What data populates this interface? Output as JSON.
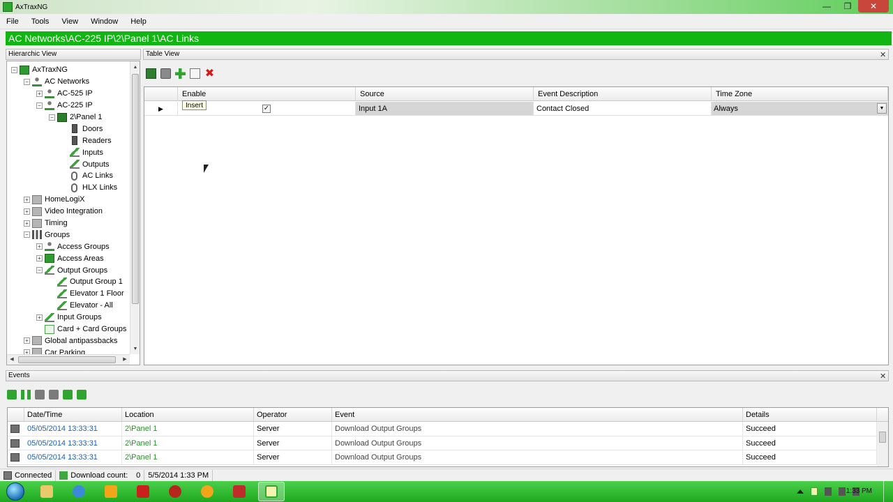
{
  "window": {
    "title": "AxTraxNG",
    "minimize_icon": "minimize-icon",
    "maximize_icon": "restore-icon",
    "close_icon": "close-icon"
  },
  "menu": [
    "File",
    "Tools",
    "View",
    "Window",
    "Help"
  ],
  "path_bar": "AC Networks\\AC-225 IP\\2\\Panel 1\\AC Links",
  "hierarchic": {
    "header": "Hierarchic View",
    "items": [
      {
        "label": "AxTraxNG",
        "indent": 0,
        "exp": "−",
        "icon": "app"
      },
      {
        "label": "AC Networks",
        "indent": 1,
        "exp": "−",
        "icon": "net"
      },
      {
        "label": "AC-525 IP",
        "indent": 2,
        "exp": "+",
        "icon": "net"
      },
      {
        "label": "AC-225 IP",
        "indent": 2,
        "exp": "−",
        "icon": "net"
      },
      {
        "label": "2\\Panel 1",
        "indent": 3,
        "exp": "−",
        "icon": "panel"
      },
      {
        "label": "Doors",
        "indent": 4,
        "exp": "",
        "icon": "door"
      },
      {
        "label": "Readers",
        "indent": 4,
        "exp": "",
        "icon": "door"
      },
      {
        "label": "Inputs",
        "indent": 4,
        "exp": "",
        "icon": "arrow"
      },
      {
        "label": "Outputs",
        "indent": 4,
        "exp": "",
        "icon": "arrow"
      },
      {
        "label": "AC Links",
        "indent": 4,
        "exp": "",
        "icon": "link"
      },
      {
        "label": "HLX Links",
        "indent": 4,
        "exp": "",
        "icon": "link"
      },
      {
        "label": "HomeLogiX",
        "indent": 1,
        "exp": "+",
        "icon": "gray"
      },
      {
        "label": "Video Integration",
        "indent": 1,
        "exp": "+",
        "icon": "gray"
      },
      {
        "label": "Timing",
        "indent": 1,
        "exp": "+",
        "icon": "gray"
      },
      {
        "label": "Groups",
        "indent": 1,
        "exp": "−",
        "icon": "group"
      },
      {
        "label": "Access Groups",
        "indent": 2,
        "exp": "+",
        "icon": "net"
      },
      {
        "label": "Access Areas",
        "indent": 2,
        "exp": "+",
        "icon": "green"
      },
      {
        "label": "Output Groups",
        "indent": 2,
        "exp": "−",
        "icon": "arrow"
      },
      {
        "label": "Output Group 1",
        "indent": 3,
        "exp": "",
        "icon": "arrow"
      },
      {
        "label": "Elevator 1 Floor",
        "indent": 3,
        "exp": "",
        "icon": "arrow"
      },
      {
        "label": "Elevator - All",
        "indent": 3,
        "exp": "",
        "icon": "arrow"
      },
      {
        "label": "Input Groups",
        "indent": 2,
        "exp": "+",
        "icon": "arrow"
      },
      {
        "label": "Card + Card Groups",
        "indent": 2,
        "exp": "",
        "icon": "card"
      },
      {
        "label": "Global antipassbacks",
        "indent": 1,
        "exp": "+",
        "icon": "gray"
      },
      {
        "label": "Car Parking",
        "indent": 1,
        "exp": "+",
        "icon": "gray"
      }
    ]
  },
  "table_view": {
    "header": "Table View",
    "toolbar_icons": [
      "save-icon",
      "print-icon",
      "add-icon",
      "edit-icon",
      "delete-icon"
    ],
    "columns": [
      "Enable",
      "Source",
      "Event Description",
      "Time Zone"
    ],
    "row": {
      "enable_checked": true,
      "source": "Input 1A",
      "event_description": "Contact Closed",
      "time_zone": "Always"
    },
    "tooltip": "Insert"
  },
  "events": {
    "header": "Events",
    "columns": [
      "Date/Time",
      "Location",
      "Operator",
      "Event",
      "Details"
    ],
    "rows": [
      {
        "datetime": "05/05/2014 13:33:31",
        "location": "2\\Panel 1",
        "operator": "Server",
        "event": "Download Output Groups",
        "details": "Succeed"
      },
      {
        "datetime": "05/05/2014 13:33:31",
        "location": "2\\Panel 1",
        "operator": "Server",
        "event": "Download Output Groups",
        "details": "Succeed"
      },
      {
        "datetime": "05/05/2014 13:33:31",
        "location": "2\\Panel 1",
        "operator": "Server",
        "event": "Download Output Groups",
        "details": "Succeed"
      }
    ]
  },
  "status": {
    "connected": "Connected",
    "download_label": "Download count:",
    "download_count": "0",
    "datetime": "5/5/2014 1:33 PM"
  },
  "taskbar": {
    "clock": "1:33 PM"
  },
  "colors": {
    "path_bar": "#12b612",
    "taskbar": "#2fbf2f",
    "link_text": "#1f5fb0",
    "location_text": "#2a8f2a"
  }
}
